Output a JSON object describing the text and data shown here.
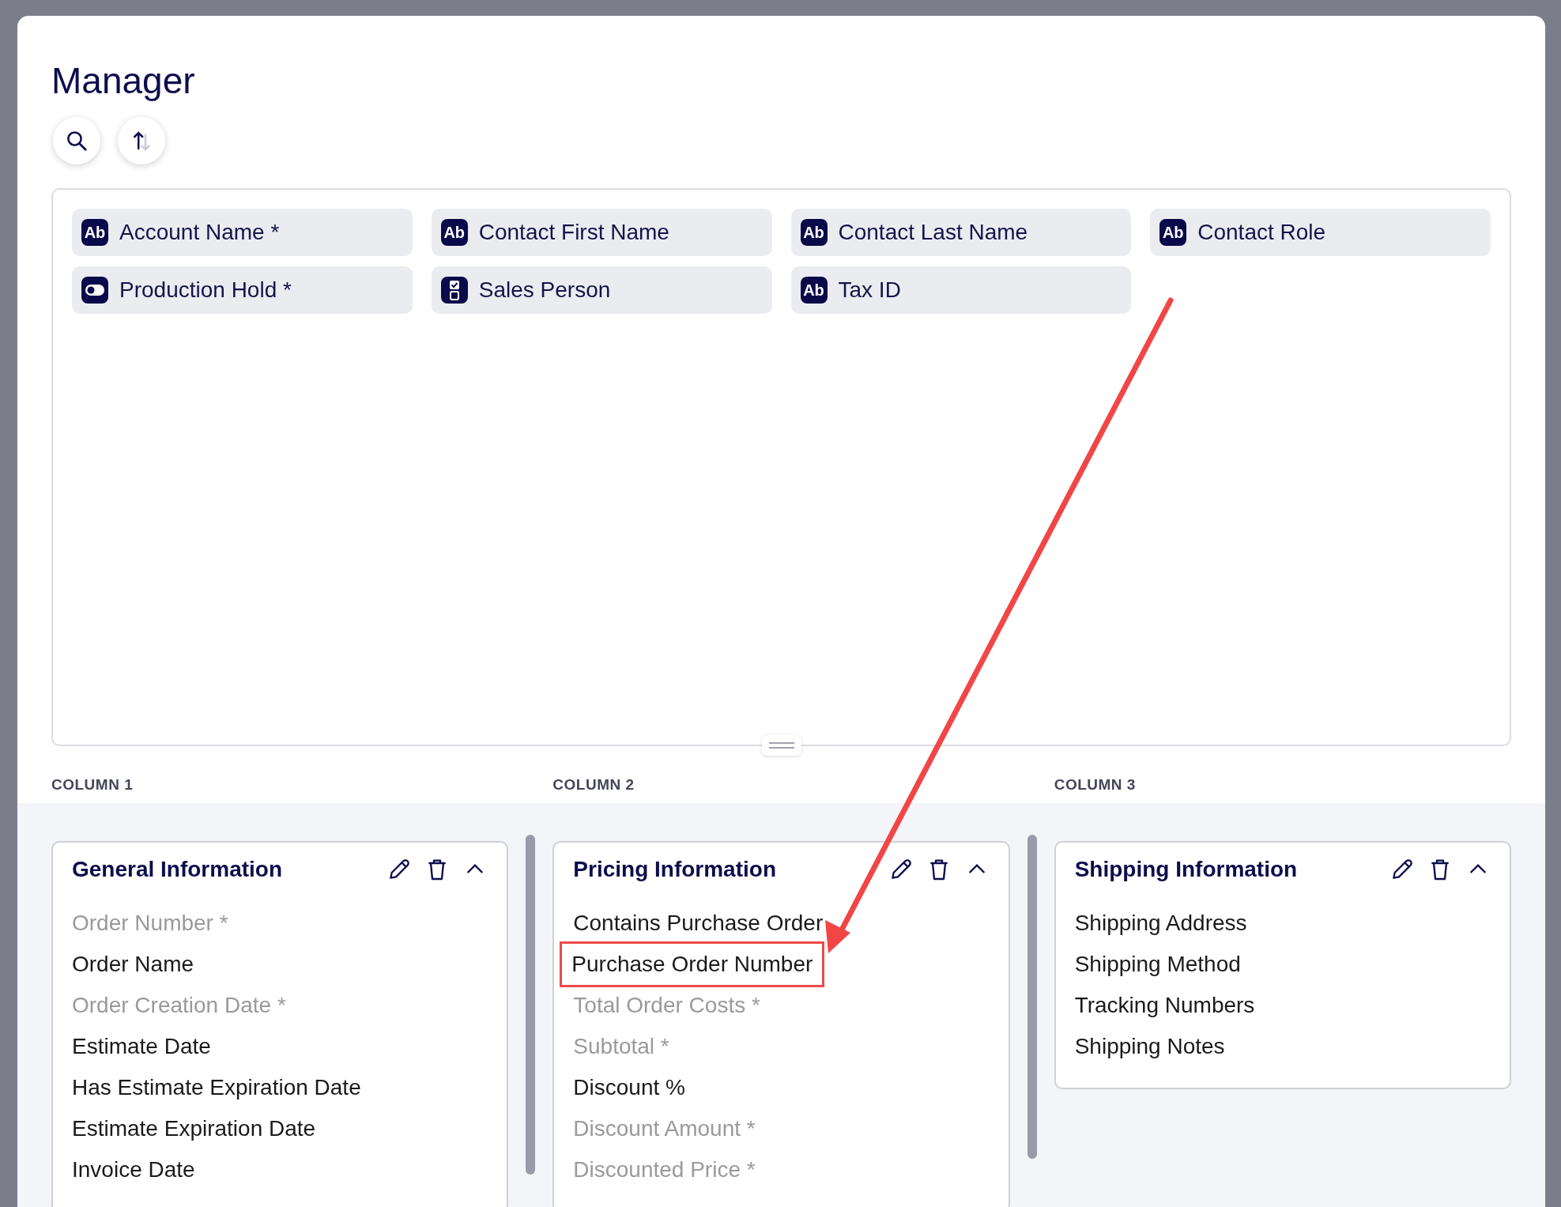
{
  "page": {
    "title": "Manager"
  },
  "toolbar": [
    {
      "kind": "search"
    },
    {
      "kind": "sort"
    }
  ],
  "field_pool": [
    {
      "kind": "text",
      "icon_label": "Ab",
      "label": "Account Name *"
    },
    {
      "kind": "text",
      "icon_label": "Ab",
      "label": "Contact First Name"
    },
    {
      "kind": "text",
      "icon_label": "Ab",
      "label": "Contact Last Name"
    },
    {
      "kind": "text",
      "icon_label": "Ab",
      "label": "Contact Role"
    },
    {
      "kind": "toggle",
      "label": "Production Hold *"
    },
    {
      "kind": "checklist",
      "label": "Sales Person"
    },
    {
      "kind": "text",
      "icon_label": "Ab",
      "label": "Tax ID"
    }
  ],
  "columns": [
    {
      "heading": "COLUMN 1",
      "sections": [
        {
          "title": "General Information",
          "expanded": true,
          "fields": [
            {
              "label": "Order Number *",
              "disabled": true,
              "highlighted": false
            },
            {
              "label": "Order Name",
              "disabled": false,
              "highlighted": false
            },
            {
              "label": "Order Creation Date *",
              "disabled": true,
              "highlighted": false
            },
            {
              "label": "Estimate Date",
              "disabled": false,
              "highlighted": false
            },
            {
              "label": "Has Estimate Expiration Date",
              "disabled": false,
              "highlighted": false
            },
            {
              "label": "Estimate Expiration Date",
              "disabled": false,
              "highlighted": false
            },
            {
              "label": "Invoice Date",
              "disabled": false,
              "highlighted": false
            }
          ]
        }
      ]
    },
    {
      "heading": "COLUMN 2",
      "sections": [
        {
          "title": "Pricing Information",
          "expanded": true,
          "fields": [
            {
              "label": "Contains Purchase Order",
              "disabled": false,
              "highlighted": false
            },
            {
              "label": "Purchase Order Number",
              "disabled": false,
              "highlighted": true
            },
            {
              "label": "Total Order Costs *",
              "disabled": true,
              "highlighted": false
            },
            {
              "label": "Subtotal *",
              "disabled": true,
              "highlighted": false
            },
            {
              "label": "Discount %",
              "disabled": false,
              "highlighted": false
            },
            {
              "label": "Discount Amount *",
              "disabled": true,
              "highlighted": false
            },
            {
              "label": "Discounted Price *",
              "disabled": true,
              "highlighted": false
            }
          ]
        }
      ]
    },
    {
      "heading": "COLUMN 3",
      "sections": [
        {
          "title": "Shipping Information",
          "expanded": true,
          "fields": [
            {
              "label": "Shipping Address",
              "disabled": false,
              "highlighted": false
            },
            {
              "label": "Shipping Method",
              "disabled": false,
              "highlighted": false
            },
            {
              "label": "Tracking Numbers",
              "disabled": false,
              "highlighted": false
            },
            {
              "label": "Shipping Notes",
              "disabled": false,
              "highlighted": false
            }
          ]
        }
      ]
    }
  ]
}
